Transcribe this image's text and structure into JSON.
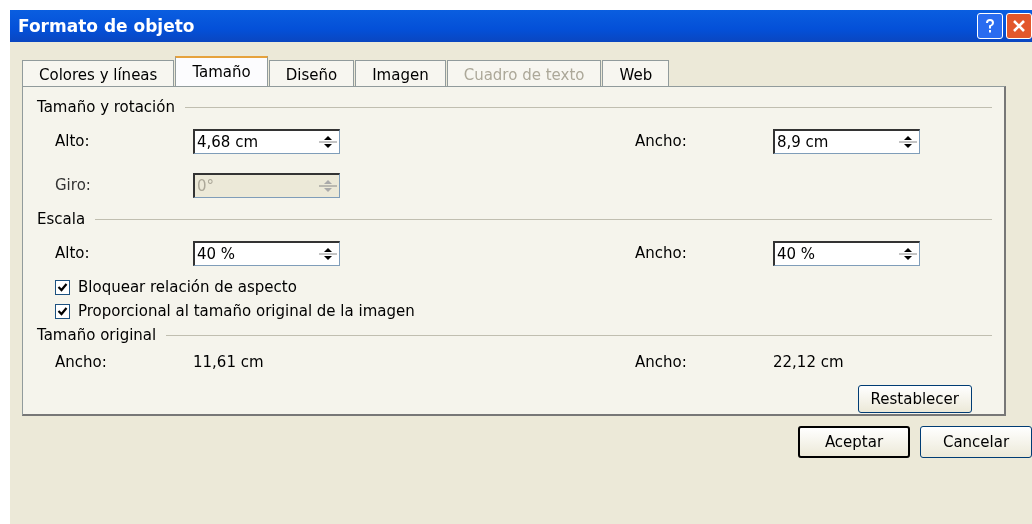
{
  "window": {
    "title": "Formato de objeto"
  },
  "tabs": [
    {
      "label": "Colores y líneas",
      "selected": false,
      "disabled": false
    },
    {
      "label": "Tamaño",
      "selected": true,
      "disabled": false
    },
    {
      "label": "Diseño",
      "selected": false,
      "disabled": false
    },
    {
      "label": "Imagen",
      "selected": false,
      "disabled": false
    },
    {
      "label": "Cuadro de texto",
      "selected": false,
      "disabled": true
    },
    {
      "label": "Web",
      "selected": false,
      "disabled": false
    }
  ],
  "sections": [
    {
      "title": "Tamaño y rotación",
      "rows": [
        [
          {
            "label": "Alto:",
            "value": "4,68 cm",
            "disabled": false
          },
          {
            "label": "Ancho:",
            "value": "8,9 cm",
            "disabled": false
          }
        ],
        [
          {
            "label": "Giro:",
            "value": "0°",
            "disabled": true
          }
        ]
      ]
    },
    {
      "title": "Escala",
      "rows": [
        [
          {
            "label": "Alto:",
            "value": "40 %",
            "disabled": false
          },
          {
            "label": "Ancho:",
            "value": "40 %",
            "disabled": false
          }
        ]
      ],
      "checkboxes": [
        {
          "label": "Bloquear relación de aspecto",
          "checked": true
        },
        {
          "label": "Proporcional al tamaño original de la imagen",
          "checked": true
        }
      ]
    },
    {
      "title": "Tamaño original",
      "info": [
        {
          "label": "Ancho:",
          "value": "11,61 cm"
        },
        {
          "label": "Ancho:",
          "value": "22,12 cm"
        }
      ],
      "button": "Restablecer"
    }
  ],
  "buttons": [
    "Aceptar",
    "Cancelar"
  ]
}
